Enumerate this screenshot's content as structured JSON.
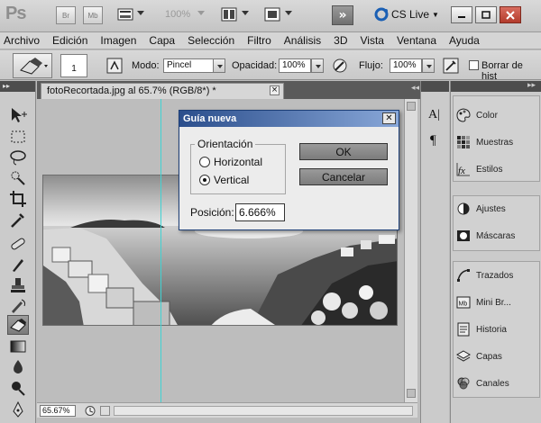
{
  "app": {
    "logo": "Ps",
    "bridge_label": "Br",
    "minibridge_label": "Mb",
    "zoom_display": "100%",
    "cs_live": "CS Live"
  },
  "menu": [
    "Archivo",
    "Edición",
    "Imagen",
    "Capa",
    "Selección",
    "Filtro",
    "Análisis",
    "3D",
    "Vista",
    "Ventana",
    "Ayuda"
  ],
  "options": {
    "brush_size": "1",
    "mode_label": "Modo:",
    "mode_value": "Pincel",
    "opacity_label": "Opacidad:",
    "opacity_value": "100%",
    "flow_label": "Flujo:",
    "flow_value": "100%",
    "erase_history_label": "Borrar de hist"
  },
  "document": {
    "tab_title": "fotoRecortada.jpg al 65.7% (RGB/8*) *",
    "close_glyph": "×",
    "zoom_status": "65.67%"
  },
  "dialog": {
    "title": "Guía nueva",
    "close_glyph": "✕",
    "orientation_legend": "Orientación",
    "horizontal_label": "Horizontal",
    "vertical_label": "Vertical",
    "selected_orientation": "vertical",
    "ok_label": "OK",
    "cancel_label": "Cancelar",
    "position_label": "Posición:",
    "position_value": "6.666%"
  },
  "panel_strip": {
    "character_icon": "A|",
    "paragraph_icon": "¶"
  },
  "panels": {
    "group1": [
      "Color",
      "Muestras",
      "Estilos"
    ],
    "group2": [
      "Ajustes",
      "Máscaras"
    ],
    "group3": [
      "Trazados",
      "Mini Br...",
      "Historia",
      "Capas",
      "Canales"
    ]
  },
  "colors": {
    "guide": "#3fd3d3",
    "dialog_title_start": "#2b4e8c",
    "dialog_title_end": "#88a7d8"
  }
}
